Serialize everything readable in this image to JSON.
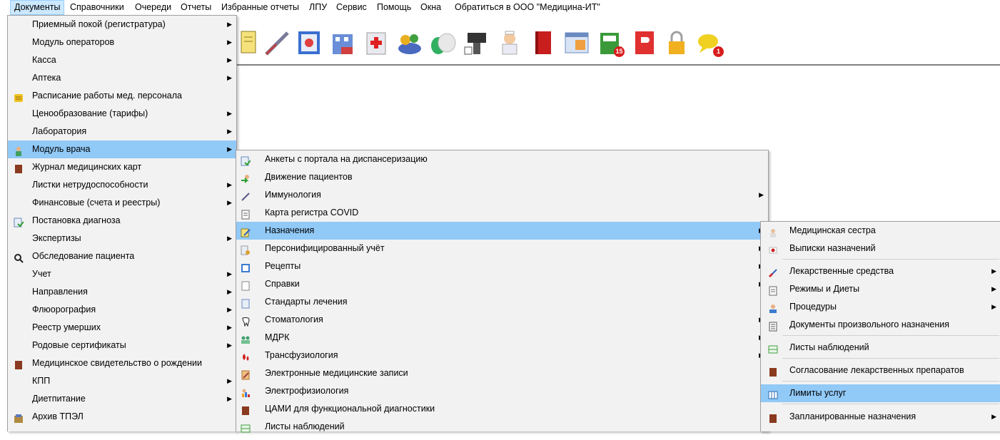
{
  "menubar": {
    "items": [
      "Документы",
      "Справочники",
      "Очереди",
      "Отчеты",
      "Избранные отчеты",
      "ЛПУ",
      "Сервис",
      "Помощь",
      "Окна",
      "Обратиться в ООО \"Медицина-ИТ\""
    ]
  },
  "toolbar": {
    "badges": [
      "15",
      "1"
    ]
  },
  "menu1": {
    "items": [
      {
        "label": "Приемный покой (регистратура)",
        "arrow": "▶"
      },
      {
        "label": "Модуль операторов",
        "arrow": "▶"
      },
      {
        "label": "Касса",
        "arrow": "▶"
      },
      {
        "label": "Аптека",
        "arrow": "▶"
      },
      {
        "label": "Расписание работы мед. персонала",
        "arrow": ""
      },
      {
        "label": "Ценообразование (тарифы)",
        "arrow": "▶"
      },
      {
        "label": "Лаборатория",
        "arrow": "▶"
      },
      {
        "label": "Модуль врача",
        "arrow": "▶"
      },
      {
        "label": "Журнал медицинских карт",
        "arrow": ""
      },
      {
        "label": "Листки нетрудоспособности",
        "arrow": "▶"
      },
      {
        "label": "Финансовые (счета и реестры)",
        "arrow": "▶"
      },
      {
        "label": "Постановка диагноза",
        "arrow": ""
      },
      {
        "label": "Экспертизы",
        "arrow": "▶"
      },
      {
        "label": "Обследование пациента",
        "arrow": ""
      },
      {
        "label": "Учет",
        "arrow": "▶"
      },
      {
        "label": "Направления",
        "arrow": "▶"
      },
      {
        "label": "Флюорография",
        "arrow": "▶"
      },
      {
        "label": "Реестр умерших",
        "arrow": "▶"
      },
      {
        "label": "Родовые сертификаты",
        "arrow": "▶"
      },
      {
        "label": "Медицинское свидетельство о рождении",
        "arrow": ""
      },
      {
        "label": "КПП",
        "arrow": "▶"
      },
      {
        "label": "Диетпитание",
        "arrow": "▶"
      },
      {
        "label": "Архив ТПЭЛ",
        "arrow": ""
      }
    ]
  },
  "menu2": {
    "items": [
      {
        "label": "Анкеты с портала на диспансеризацию",
        "arrow": ""
      },
      {
        "label": "Движение пациентов",
        "arrow": ""
      },
      {
        "label": "Иммунология",
        "arrow": "▶"
      },
      {
        "label": "Карта регистра COVID",
        "arrow": ""
      },
      {
        "label": "Назначения",
        "arrow": "▶"
      },
      {
        "label": "Персонифицированный учёт",
        "arrow": "▶"
      },
      {
        "label": "Рецепты",
        "arrow": "▶"
      },
      {
        "label": "Справки",
        "arrow": "▶"
      },
      {
        "label": "Стандарты лечения",
        "arrow": ""
      },
      {
        "label": "Стоматология",
        "arrow": "▶"
      },
      {
        "label": "МДРК",
        "arrow": "▶"
      },
      {
        "label": "Трансфузиология",
        "arrow": "▶"
      },
      {
        "label": "Электронные медицинские записи",
        "arrow": ""
      },
      {
        "label": "Электрофизиология",
        "arrow": ""
      },
      {
        "label": "ЦАМИ для функциональной диагностики",
        "arrow": ""
      },
      {
        "label": "Листы наблюдений",
        "arrow": ""
      }
    ]
  },
  "menu3": {
    "items": [
      {
        "label": "Медицинская сестра",
        "arrow": ""
      },
      {
        "label": "Выписки назначений",
        "arrow": ""
      },
      {
        "label": "Лекарственные средства",
        "arrow": "▶"
      },
      {
        "label": "Режимы и Диеты",
        "arrow": "▶"
      },
      {
        "label": "Процедуры",
        "arrow": "▶"
      },
      {
        "label": "Документы произвольного назначения",
        "arrow": ""
      },
      {
        "label": "Листы наблюдений",
        "arrow": ""
      },
      {
        "label": "Согласование лекарственных препаратов",
        "arrow": ""
      },
      {
        "label": "Лимиты услуг",
        "arrow": ""
      },
      {
        "label": "Запланированные назначения",
        "arrow": "▶"
      }
    ]
  },
  "colors": {
    "highlight": "#91c9f7",
    "menu_bg": "#f2f2f2",
    "badge": "#d81c1c"
  }
}
